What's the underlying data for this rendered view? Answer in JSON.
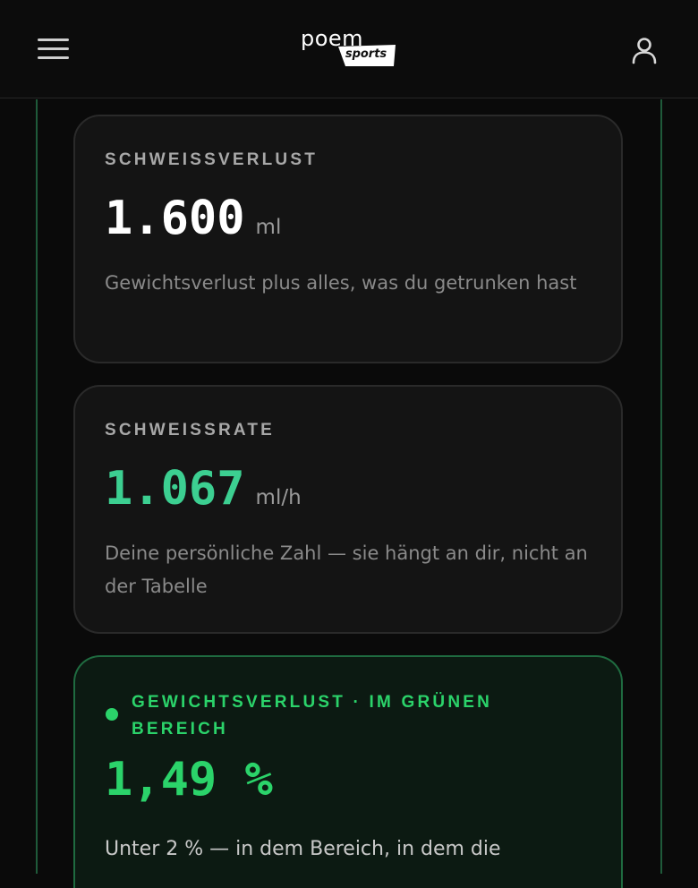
{
  "header": {
    "logo_word": "poem",
    "logo_tag": "sports",
    "icons": {
      "menu": "hamburger-menu-icon",
      "user": "user-profile-icon"
    }
  },
  "colors": {
    "accent_teal": "#3ccf91",
    "accent_green": "#2bd36a",
    "frame_line": "#1f5a3a"
  },
  "cards": [
    {
      "label": "SCHWEISSVERLUST",
      "value": "1.600",
      "unit": "ml",
      "description": "Gewichtsverlust plus alles, was du getrunken hast"
    },
    {
      "label": "SCHWEISSRATE",
      "value": "1.067",
      "unit": "ml/h",
      "description": "Deine persönliche Zahl — sie hängt an dir, nicht an der Tabelle"
    },
    {
      "label": "GEWICHTSVERLUST · IM GRÜNEN BEREICH",
      "value": "1,49 %",
      "description": "Unter 2 % — in dem Bereich, in dem die"
    }
  ]
}
